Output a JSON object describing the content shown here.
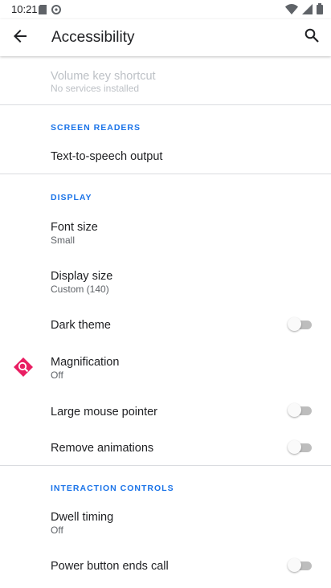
{
  "status_bar": {
    "time": "10:21"
  },
  "app_bar": {
    "title": "Accessibility"
  },
  "items": {
    "volume_key_shortcut": {
      "title": "Volume key shortcut",
      "summary": "No services installed"
    },
    "text_to_speech": {
      "title": "Text-to-speech output"
    },
    "font_size": {
      "title": "Font size",
      "summary": "Small"
    },
    "display_size": {
      "title": "Display size",
      "summary": "Custom (140)"
    },
    "dark_theme": {
      "title": "Dark theme",
      "checked": false
    },
    "magnification": {
      "title": "Magnification",
      "summary": "Off"
    },
    "large_mouse_pointer": {
      "title": "Large mouse pointer",
      "checked": false
    },
    "remove_animations": {
      "title": "Remove animations",
      "checked": false
    },
    "dwell_timing": {
      "title": "Dwell timing",
      "summary": "Off"
    },
    "power_button_ends_call": {
      "title": "Power button ends call",
      "checked": false
    }
  },
  "sections": {
    "screen_readers": "SCREEN READERS",
    "display": "DISPLAY",
    "interaction_controls": "INTERACTION CONTROLS"
  },
  "colors": {
    "accent": "#1a73e8",
    "magnification_icon": "#e91e63"
  }
}
